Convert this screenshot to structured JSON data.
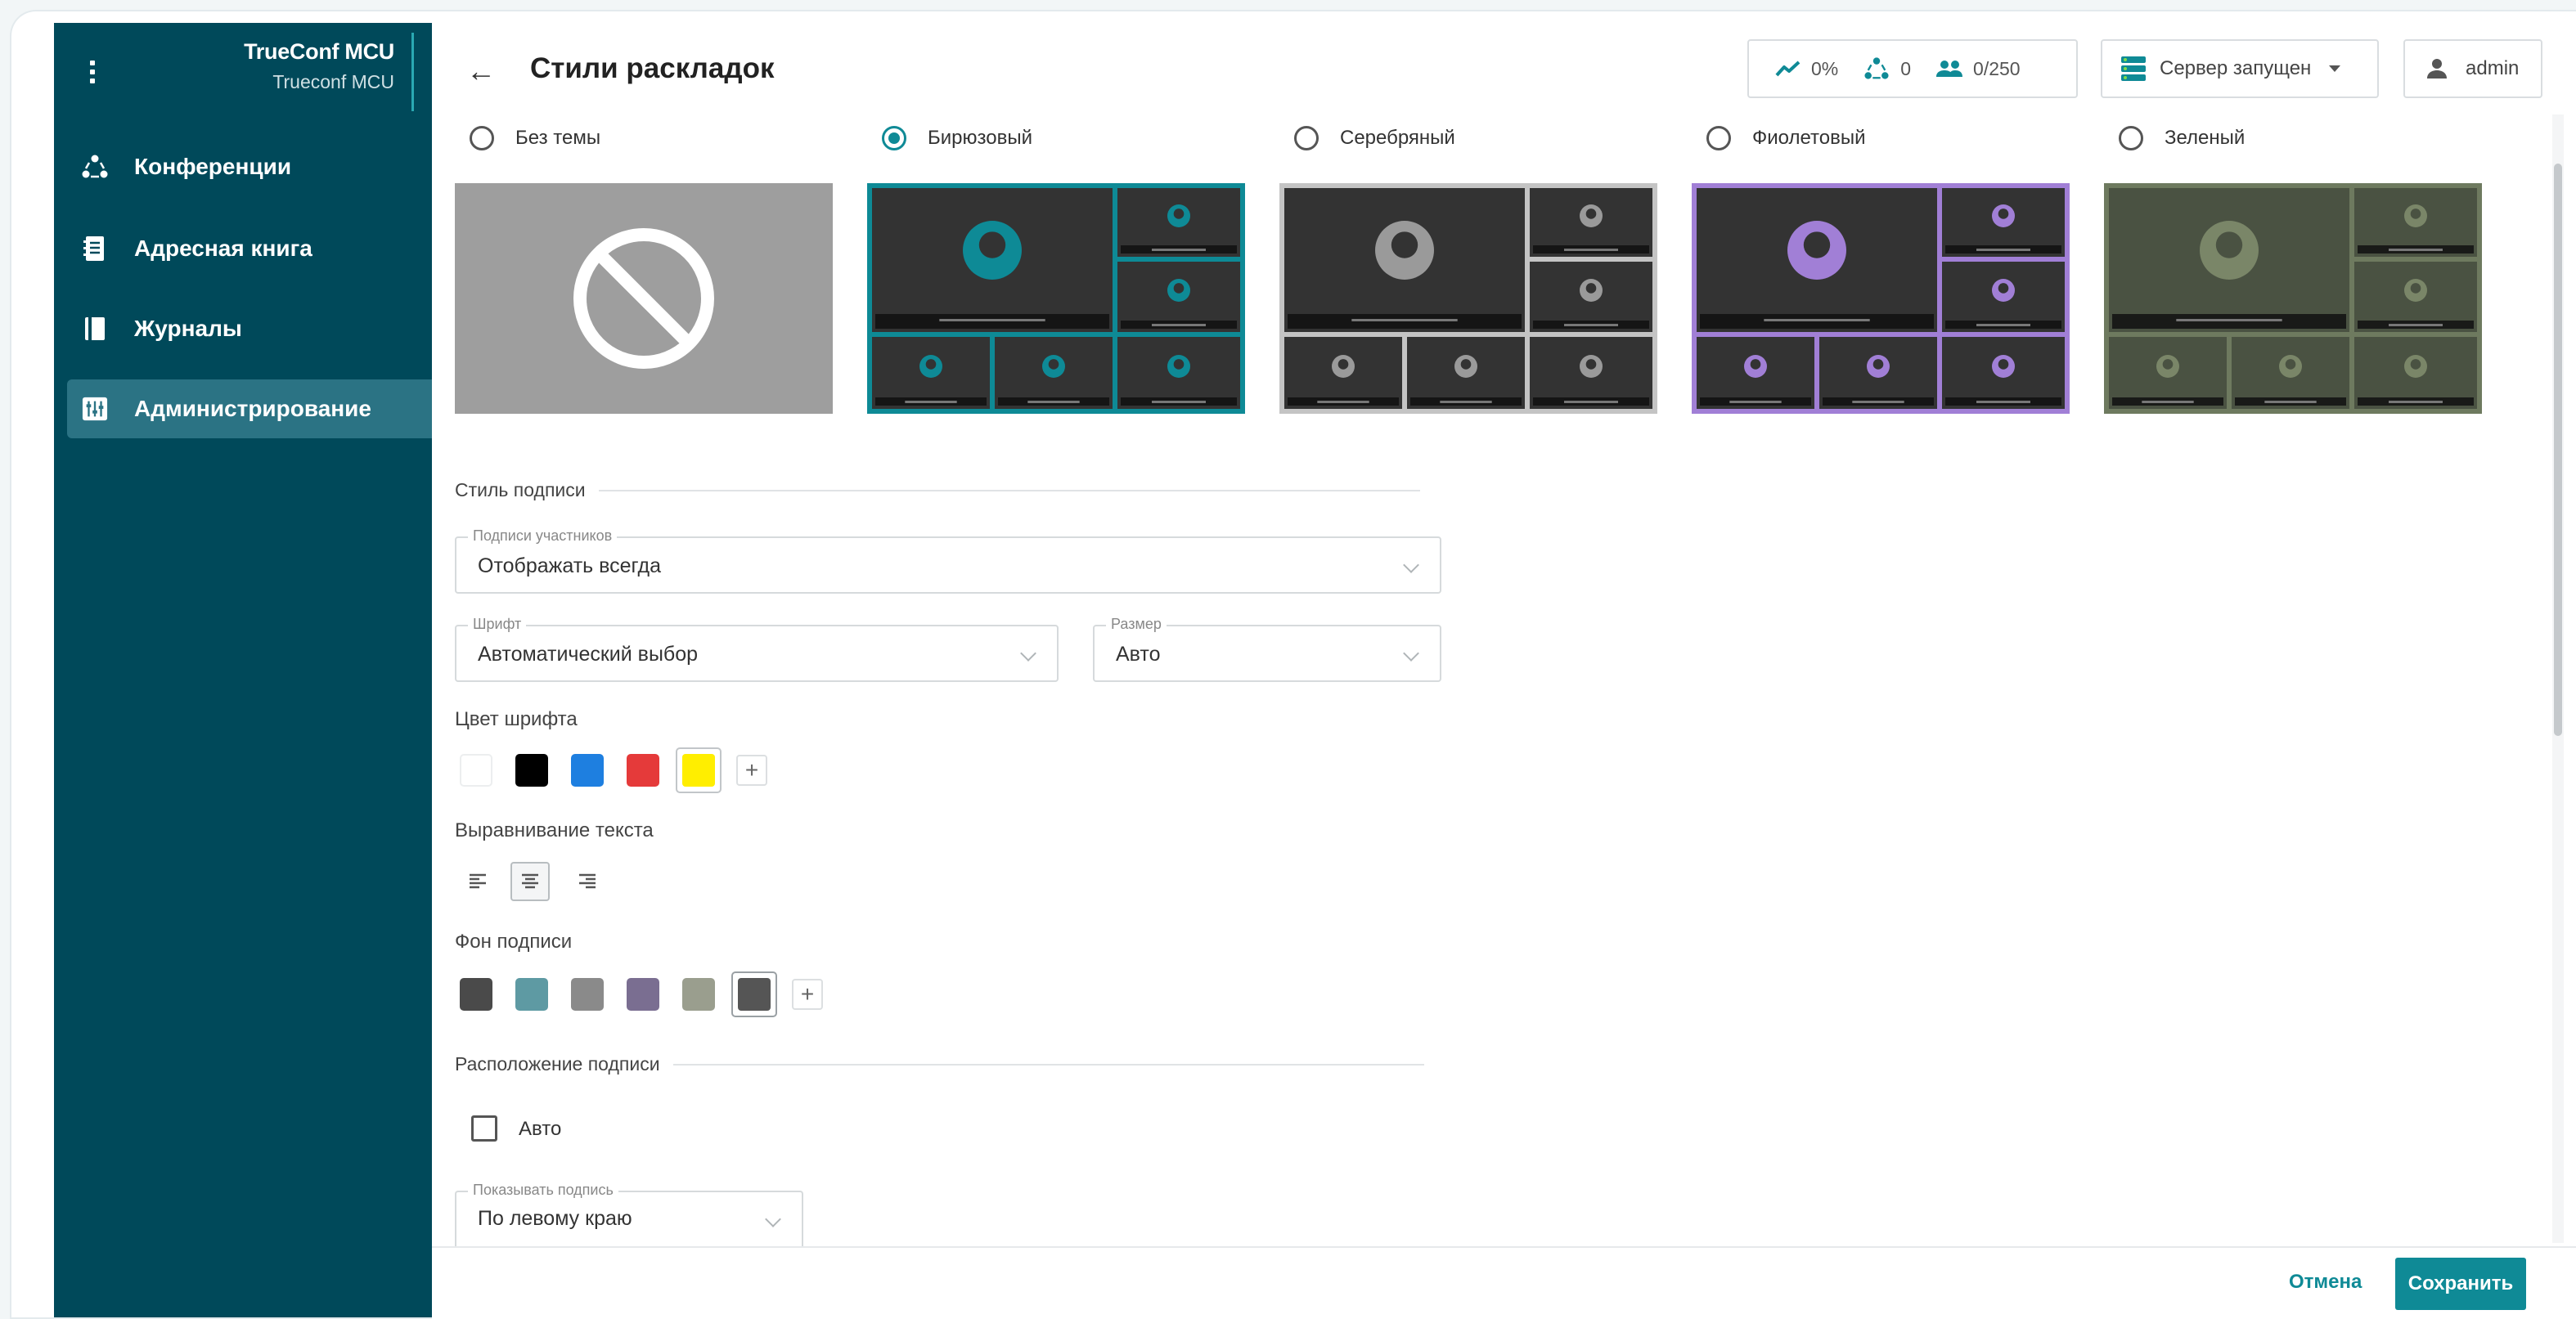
{
  "sidebar": {
    "title": "TrueConf MCU",
    "subtitle": "Trueconf MCU",
    "items": [
      {
        "label": "Конференции",
        "icon": "conferences-icon"
      },
      {
        "label": "Адресная книга",
        "icon": "address-book-icon"
      },
      {
        "label": "Журналы",
        "icon": "logs-icon"
      },
      {
        "label": "Администрирование",
        "icon": "administration-icon",
        "active": true
      }
    ]
  },
  "header": {
    "title": "Стили раскладок",
    "load": "0%",
    "conferences": "0",
    "participants": "0/250",
    "server_status": "Сервер запущен",
    "user": "admin"
  },
  "themes": {
    "options": [
      {
        "label": "Без темы",
        "selected": false
      },
      {
        "label": "Бирюзовый",
        "selected": true,
        "color": "#0e8a96"
      },
      {
        "label": "Серебряный",
        "selected": false,
        "color": "#c4c4c4"
      },
      {
        "label": "Фиолетовый",
        "selected": false,
        "color": "#a17fd6"
      },
      {
        "label": "Зеленый",
        "selected": false,
        "color": "#6e7a5f"
      }
    ]
  },
  "caption_style": {
    "section": "Стиль подписи",
    "participants_label": "Подписи участников",
    "participants_value": "Отображать всегда",
    "font_label": "Шрифт",
    "font_value": "Автоматический выбор",
    "size_label": "Размер",
    "size_value": "Авто",
    "font_color_label": "Цвет шрифта",
    "font_colors": [
      "#ffffff",
      "#000000",
      "#1e7fe0",
      "#e53a3a",
      "#ffee00"
    ],
    "selected_font_color": "#ffee00",
    "align_label": "Выравнивание текста",
    "align_options": [
      "left",
      "center",
      "right"
    ],
    "selected_align": "center",
    "bg_label": "Фон подписи",
    "bg_colors": [
      "#4a4a4a",
      "#5e9aa3",
      "#8a8a8a",
      "#7a6e91",
      "#9a9e8e",
      "#555555"
    ],
    "selected_bg": "#555555"
  },
  "caption_position": {
    "section": "Расположение подписи",
    "auto_label": "Авто",
    "auto_checked": false,
    "show_label": "Показывать подпись",
    "show_value": "По левому краю"
  },
  "footer": {
    "cancel": "Отмена",
    "save": "Сохранить"
  },
  "colors": {
    "sidebar": "#00495a",
    "accent": "#0f8a96"
  }
}
